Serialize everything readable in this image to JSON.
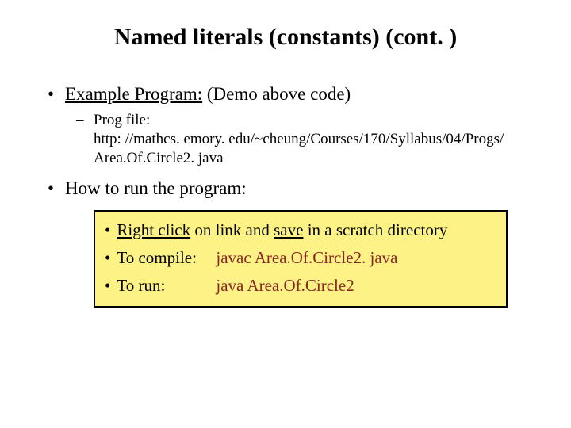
{
  "title": "Named literals (constants) (cont. )",
  "bullet1": {
    "label": "Example Program:",
    "rest": " (Demo above code)"
  },
  "sub1": {
    "label": "Prog file:",
    "url_line": "http: //mathcs. emory. edu/~cheung/Courses/170/Syllabus/04/Progs/ Area.Of.Circle2. java"
  },
  "bullet2": "How to run the program:",
  "box": {
    "row1": {
      "pre": "Right click",
      "mid": " on link and ",
      "save": "save",
      "post": " in a scratch directory"
    },
    "row2": {
      "label": "To compile:",
      "cmd": "javac Area.Of.Circle2. java"
    },
    "row3": {
      "label": "To run:",
      "cmd": "java Area.Of.Circle2"
    }
  }
}
